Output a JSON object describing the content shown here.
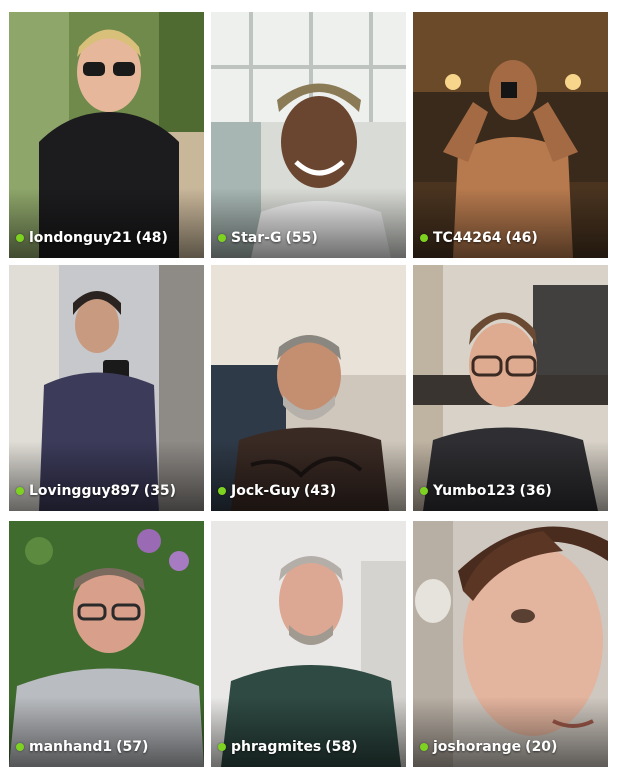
{
  "colors": {
    "online": "#7ed321",
    "caption_text": "#ffffff"
  },
  "profiles": [
    {
      "username": "londonguy21",
      "age": "(48)",
      "online": true
    },
    {
      "username": "Star-G",
      "age": "(55)",
      "online": true
    },
    {
      "username": "TC44264",
      "age": "(46)",
      "online": true
    },
    {
      "username": "Lovingguy897",
      "age": "(35)",
      "online": true
    },
    {
      "username": "Jock-Guy",
      "age": "(43)",
      "online": true
    },
    {
      "username": "Yumbo123",
      "age": "(36)",
      "online": true
    },
    {
      "username": "manhand1",
      "age": "(57)",
      "online": true
    },
    {
      "username": "phragmites",
      "age": "(58)",
      "online": true
    },
    {
      "username": "joshorange",
      "age": "(20)",
      "online": true
    }
  ]
}
